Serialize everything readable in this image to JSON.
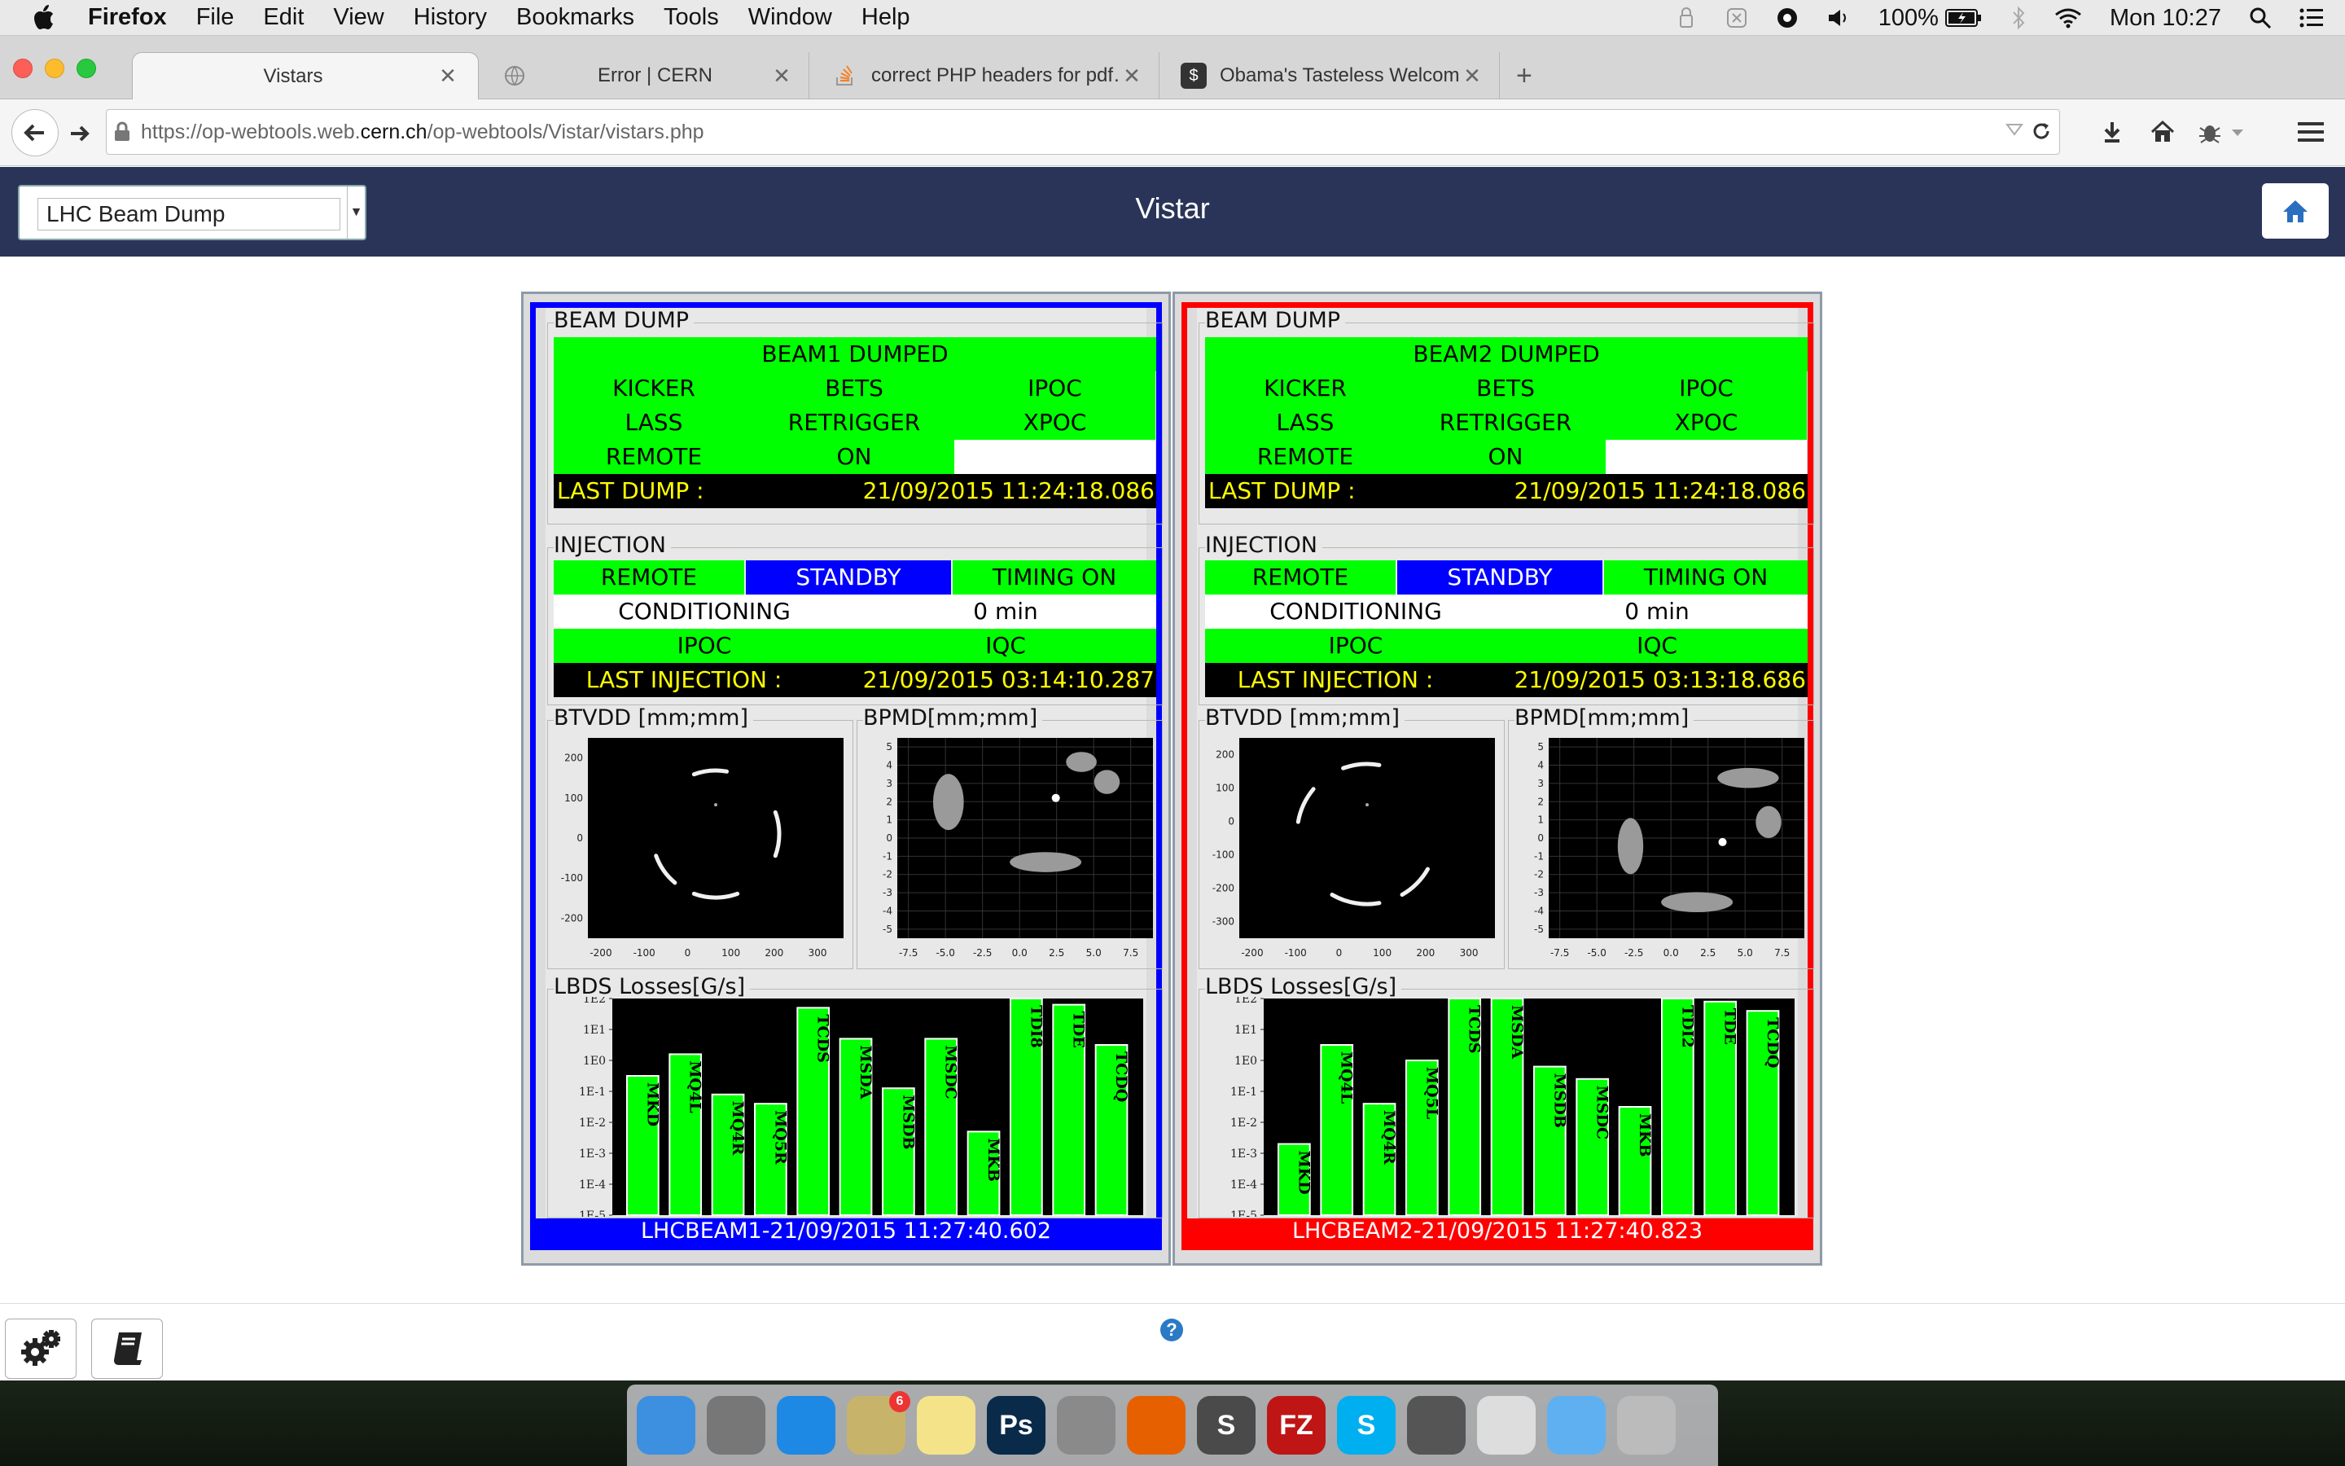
{
  "menubar": {
    "app": "Firefox",
    "items": [
      "File",
      "Edit",
      "View",
      "History",
      "Bookmarks",
      "Tools",
      "Window",
      "Help"
    ],
    "battery": "100%",
    "clock": "Mon 10:27"
  },
  "tabs": [
    {
      "label": "Vistars",
      "icon": "none"
    },
    {
      "label": "Error | CERN",
      "icon": "globe-icon"
    },
    {
      "label": "correct PHP headers for pdf…",
      "icon": "stackoverflow-icon"
    },
    {
      "label": "Obama's Tasteless Welcom…",
      "icon": "s-logo-icon"
    }
  ],
  "url": {
    "prefix": "https://op-webtools.web.",
    "domain": "cern.ch",
    "path": "/op-webtools/Vistar/vistars.php"
  },
  "app": {
    "title": "Vistar",
    "dropdown_value": "LHC Beam Dump"
  },
  "beams": [
    {
      "frame_color": "#0000ff",
      "section_dump": "BEAM DUMP",
      "dumped": "BEAM1 DUMPED",
      "grid": [
        [
          "KICKER",
          "BETS",
          "IPOC"
        ],
        [
          "LASS",
          "RETRIGGER",
          "XPOC"
        ],
        [
          "REMOTE",
          "ON",
          ""
        ]
      ],
      "last_dump_label": "LAST DUMP :",
      "last_dump": "21/09/2015 11:24:18.086",
      "section_injection": "INJECTION",
      "inj_row1": [
        "REMOTE",
        "STANDBY",
        "TIMING ON"
      ],
      "conditioning_label": "CONDITIONING",
      "conditioning_value": "0 min",
      "inj_row3": [
        "IPOC",
        "IQC"
      ],
      "last_injection_label": "LAST INJECTION :",
      "last_injection": "21/09/2015 03:14:10.287",
      "btvdd_label": "BTVDD [mm;mm]",
      "bpmd_label": "BPMD[mm;mm]",
      "btvdd_xticks": [
        "-200",
        "-100",
        "0",
        "100",
        "200",
        "300"
      ],
      "btvdd_yticks": [
        "200",
        "100",
        "0",
        "-100",
        "-200"
      ],
      "bpmd_xticks": [
        "-7.5",
        "-5.0",
        "-2.5",
        "0.0",
        "2.5",
        "5.0",
        "7.5"
      ],
      "bpmd_yticks": [
        "5",
        "4",
        "3",
        "2",
        "1",
        "0",
        "-1",
        "-2",
        "-3",
        "-4",
        "-5"
      ],
      "losses_label": "LBDS Losses[G/s]",
      "footer": "LHCBEAM1-21/09/2015 11:27:40.602"
    },
    {
      "frame_color": "#ff0000",
      "section_dump": "BEAM DUMP",
      "dumped": "BEAM2 DUMPED",
      "grid": [
        [
          "KICKER",
          "BETS",
          "IPOC"
        ],
        [
          "LASS",
          "RETRIGGER",
          "XPOC"
        ],
        [
          "REMOTE",
          "ON",
          ""
        ]
      ],
      "last_dump_label": "LAST DUMP :",
      "last_dump": "21/09/2015 11:24:18.086",
      "section_injection": "INJECTION",
      "inj_row1": [
        "REMOTE",
        "STANDBY",
        "TIMING ON"
      ],
      "conditioning_label": "CONDITIONING",
      "conditioning_value": "0 min",
      "inj_row3": [
        "IPOC",
        "IQC"
      ],
      "last_injection_label": "LAST INJECTION :",
      "last_injection": "21/09/2015 03:13:18.686",
      "btvdd_label": "BTVDD [mm;mm]",
      "bpmd_label": "BPMD[mm;mm]",
      "btvdd_xticks": [
        "-200",
        "-100",
        "0",
        "100",
        "200",
        "300"
      ],
      "btvdd_yticks": [
        "200",
        "100",
        "0",
        "-100",
        "-200",
        "-300"
      ],
      "bpmd_xticks": [
        "-7.5",
        "-5.0",
        "-2.5",
        "0.0",
        "2.5",
        "5.0",
        "7.5"
      ],
      "bpmd_yticks": [
        "5",
        "4",
        "3",
        "2",
        "1",
        "0",
        "-1",
        "-2",
        "-3",
        "-4",
        "-5"
      ],
      "losses_label": "LBDS Losses[G/s]",
      "footer": "LHCBEAM2-21/09/2015 11:27:40.823"
    }
  ],
  "chart_data": [
    {
      "type": "bar",
      "title": "LBDS Losses[G/s]",
      "y_scale": "log",
      "ylim": [
        "1E-5",
        "1E2"
      ],
      "ytick_labels": [
        "1E2",
        "1E1",
        "1E0",
        "1E-1",
        "1E-2",
        "1E-3",
        "1E-4",
        "1E-5"
      ],
      "categories": [
        "MKD",
        "MQ4L",
        "MQ4R",
        "MQ5R",
        "TCDS",
        "MSDA",
        "MSDB",
        "MSDC",
        "MKB",
        "TDI8",
        "TDE",
        "TCDQ"
      ],
      "exponents": [
        -0.5,
        0.2,
        -1.1,
        -1.4,
        1.7,
        0.7,
        -0.9,
        0.7,
        -2.3,
        2.0,
        1.8,
        0.5
      ],
      "color": "#00ff00"
    },
    {
      "type": "bar",
      "title": "LBDS Losses[G/s]",
      "y_scale": "log",
      "ylim": [
        "1E-5",
        "1E2"
      ],
      "ytick_labels": [
        "1E2",
        "1E1",
        "1E0",
        "1E-1",
        "1E-2",
        "1E-3",
        "1E-4",
        "1E-5"
      ],
      "categories": [
        "MKD",
        "MQ4L",
        "MQ4R",
        "MQ5L",
        "TCDS",
        "MSDA",
        "MSDB",
        "MSDC",
        "MKB",
        "TDI2",
        "TDE",
        "TCDQ"
      ],
      "exponents": [
        -2.7,
        0.5,
        -1.4,
        0.0,
        2.0,
        2.0,
        -0.2,
        -0.6,
        -1.5,
        2.0,
        1.9,
        1.6
      ],
      "color": "#00ff00"
    }
  ],
  "bottom": {
    "settings_icon": "gears-icon",
    "book_icon": "book-icon",
    "help_glyph": "?"
  },
  "dock": [
    {
      "name": "finder-icon",
      "color": "#3d8fe0",
      "glyph": ""
    },
    {
      "name": "launchpad-icon",
      "color": "#777",
      "glyph": ""
    },
    {
      "name": "safari-icon",
      "color": "#1e88e5",
      "glyph": ""
    },
    {
      "name": "mail-icon",
      "color": "#c8b36a",
      "glyph": "",
      "badge": "6"
    },
    {
      "name": "notes-icon",
      "color": "#f5e38a",
      "glyph": ""
    },
    {
      "name": "photoshop-icon",
      "color": "#0a2a4a",
      "glyph": "Ps"
    },
    {
      "name": "system-preferences-icon",
      "color": "#8a8a8a",
      "glyph": ""
    },
    {
      "name": "firefox-icon",
      "color": "#e66000",
      "glyph": ""
    },
    {
      "name": "sublime-text-icon",
      "color": "#4a4a4a",
      "glyph": "S"
    },
    {
      "name": "filezilla-icon",
      "color": "#bf1515",
      "glyph": "FZ"
    },
    {
      "name": "skype-icon",
      "color": "#00aff0",
      "glyph": "S"
    },
    {
      "name": "sequel-pro-icon",
      "color": "#555",
      "glyph": ""
    },
    {
      "name": "documents-icon",
      "color": "#ddd",
      "glyph": ""
    },
    {
      "name": "folder-icon",
      "color": "#5fb0f0",
      "glyph": ""
    },
    {
      "name": "trash-icon",
      "color": "#bbb",
      "glyph": ""
    }
  ]
}
